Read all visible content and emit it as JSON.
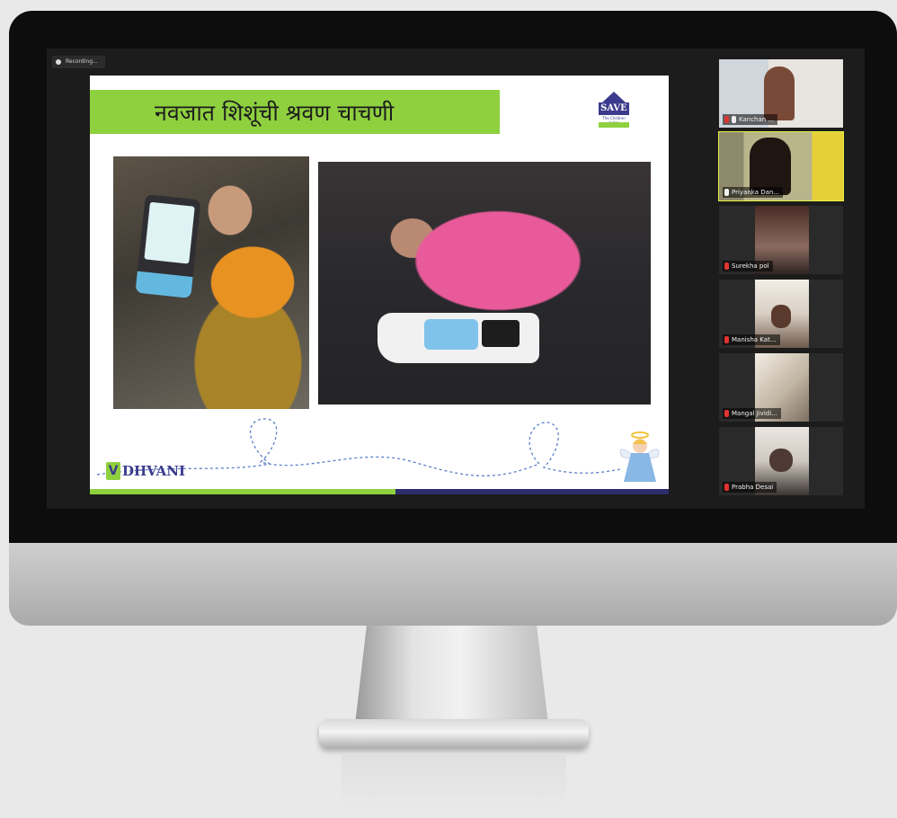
{
  "recording": {
    "label": "Recording..."
  },
  "slide": {
    "title": "नवजात शिशूंची श्रवण चाचणी",
    "logo_save": {
      "name": "SAVE",
      "tagline": "The Children India"
    },
    "logo_dhvani": {
      "mark": "V",
      "name": "DHVANI"
    }
  },
  "participants": [
    {
      "name": "Kanchan ..."
    },
    {
      "name": "Priyanka Dan..."
    },
    {
      "name": "Surekha pol"
    },
    {
      "name": "Manisha Kat..."
    },
    {
      "name": "Mangal Jividi..."
    },
    {
      "name": "Prabha Desai"
    }
  ],
  "colors": {
    "accent_green": "#8fd03f",
    "navy": "#2d2e6c",
    "active_speaker_border": "#e4f23d",
    "muted_mic": "#e0332f"
  }
}
